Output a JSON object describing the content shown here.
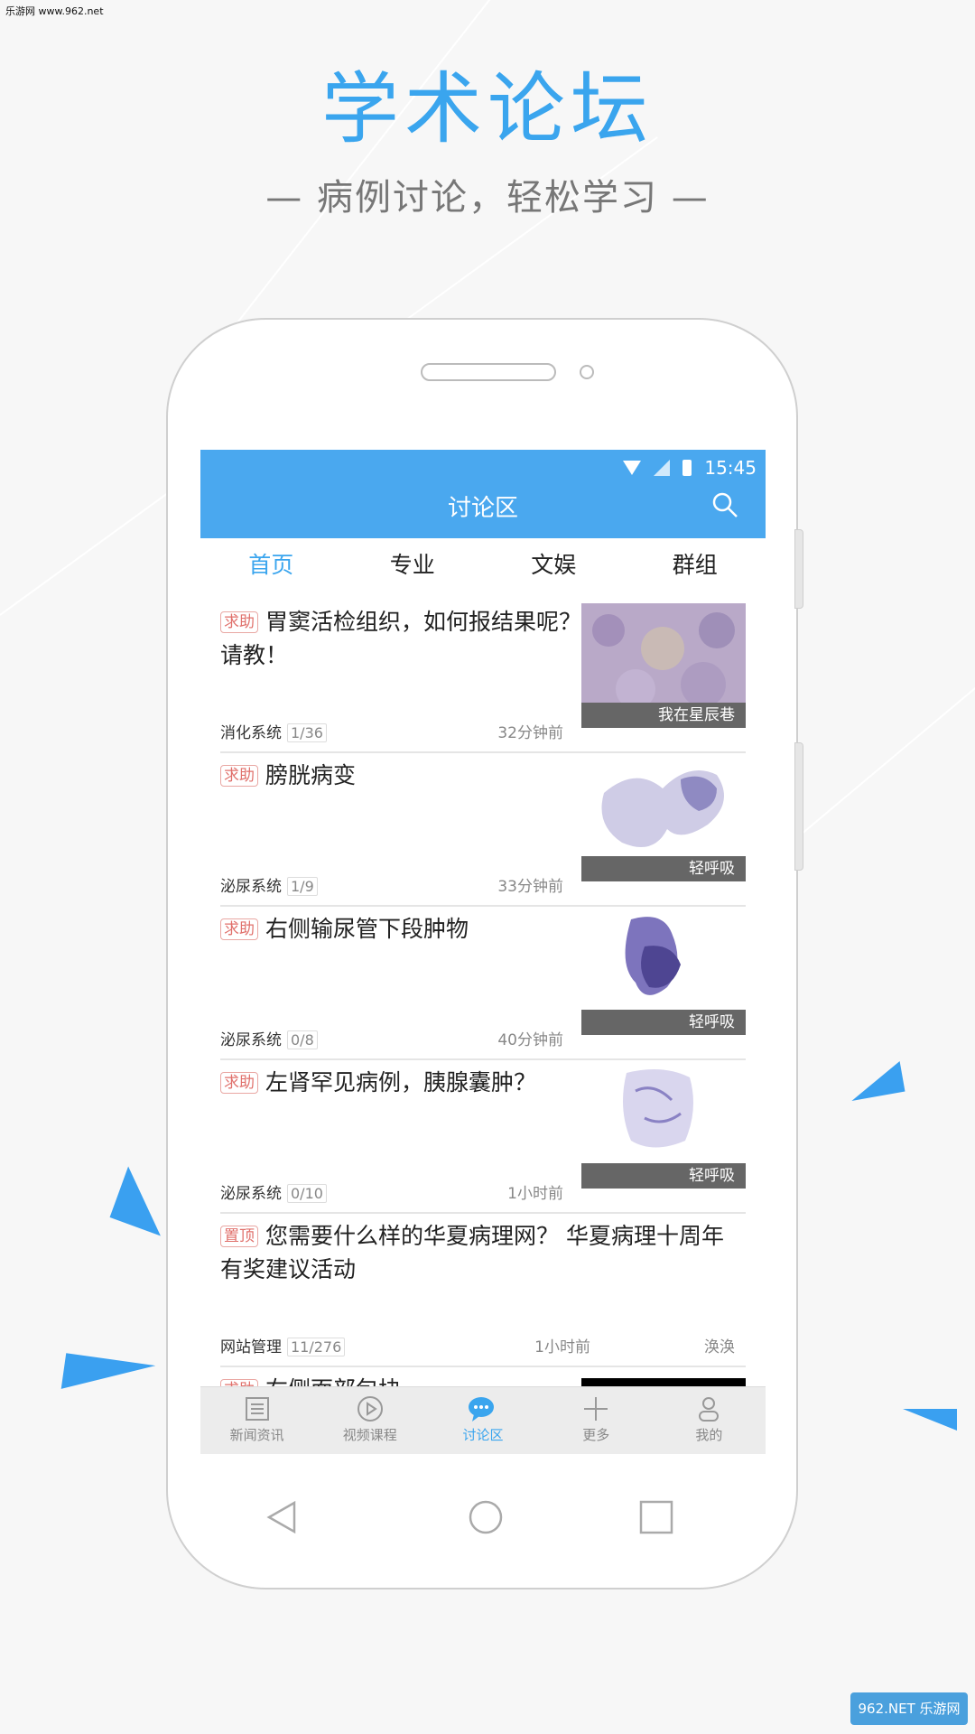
{
  "watermark_top": "乐游网 www.962.net",
  "headline": "学术论坛",
  "subline": "— 病例讨论，轻松学习 —",
  "colors": {
    "accent": "#4aa8ef",
    "tag_red": "#e0706b"
  },
  "status": {
    "time": "15:45"
  },
  "appbar": {
    "title": "讨论区",
    "search_icon": "search-icon"
  },
  "tabs": [
    {
      "label": "首页",
      "active": true
    },
    {
      "label": "专业"
    },
    {
      "label": "文娱"
    },
    {
      "label": "群组"
    }
  ],
  "posts": [
    {
      "tag": "求助",
      "title": "胃窦活检组织，如何报结果呢？请教！",
      "category": "消化系统",
      "count": "1/36",
      "time": "32分钟前",
      "thumb_caption": "我在星辰巷"
    },
    {
      "tag": "求助",
      "title": "膀胱病变",
      "category": "泌尿系统",
      "count": "1/9",
      "time": "33分钟前",
      "thumb_caption": "轻呼吸"
    },
    {
      "tag": "求助",
      "title": "右侧输尿管下段肿物",
      "category": "泌尿系统",
      "count": "0/8",
      "time": "40分钟前",
      "thumb_caption": "轻呼吸"
    },
    {
      "tag": "求助",
      "title": "左肾罕见病例，胰腺囊肿？",
      "category": "泌尿系统",
      "count": "0/10",
      "time": "1小时前",
      "thumb_caption": "轻呼吸"
    },
    {
      "tag": "置顶",
      "title": "您需要什么样的华夏病理网？ 华夏病理十周年有奖建议活动",
      "category": "网站管理",
      "count": "11/276",
      "time": "1小时前",
      "author": "涣涣"
    },
    {
      "tag": "求助",
      "title": "右侧面部包块"
    }
  ],
  "bottom_nav": [
    {
      "label": "新闻资讯",
      "icon": "news-icon"
    },
    {
      "label": "视频课程",
      "icon": "play-icon"
    },
    {
      "label": "讨论区",
      "icon": "chat-icon",
      "active": true
    },
    {
      "label": "更多",
      "icon": "plus-icon"
    },
    {
      "label": "我的",
      "icon": "user-icon"
    }
  ],
  "watermark_bottom": "962.NET 乐游网"
}
